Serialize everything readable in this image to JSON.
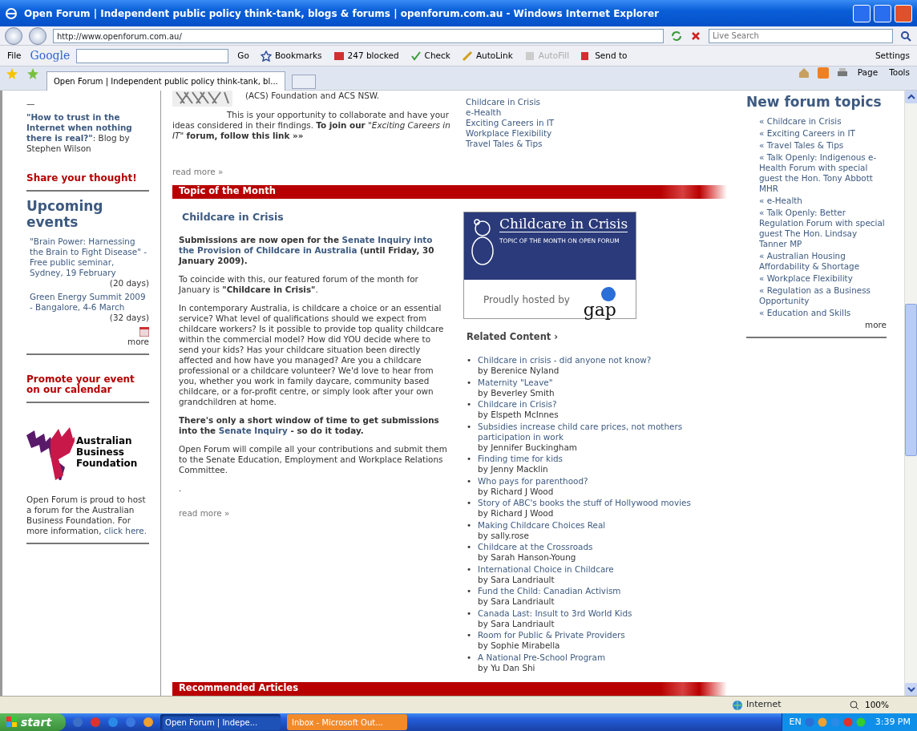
{
  "window": {
    "title": "Open Forum | Independent public policy think-tank, blogs & forums | openforum.com.au - Windows Internet Explorer"
  },
  "address_bar": {
    "url": "http://www.openforum.com.au/",
    "search_placeholder": "Live Search"
  },
  "google_toolbar": {
    "menu": "File",
    "brand": "Google",
    "go": "Go",
    "items": [
      {
        "label": "Bookmarks",
        "kind": "bookmarks",
        "disabled": false
      },
      {
        "label": "247 blocked",
        "kind": "blocked",
        "disabled": false
      },
      {
        "label": "Check",
        "kind": "check",
        "disabled": false
      },
      {
        "label": "AutoLink",
        "kind": "autolink",
        "disabled": false
      },
      {
        "label": "AutoFill",
        "kind": "autofill",
        "disabled": true
      },
      {
        "label": "Send to",
        "kind": "sendto",
        "disabled": false
      }
    ],
    "settings": "Settings"
  },
  "tabs": [
    {
      "label": "Open Forum | Independent public policy think-tank, bl...",
      "selected": true
    }
  ],
  "command_bar": {
    "page": "Page",
    "tools": "Tools"
  },
  "left_column": {
    "dash": "—",
    "blog": "**\"How to trust in the Internet when nothing there is real?\"**: Blog by Stephen Wilson",
    "share": "Share your thought!",
    "events_heading": "Upcoming events",
    "events": [
      {
        "title": "\"Brain Power: Harnessing the Brain to Fight Disease\" - Free public seminar, Sydney, 19 February",
        "days": "(20 days)"
      },
      {
        "title": "Green Energy Summit 2009 - Bangalore, 4-6 March",
        "days": "(32 days)"
      }
    ],
    "more": "more",
    "promote": "Promote your event on our calendar",
    "logo_lines": [
      "Australian",
      "Business",
      "Foundation"
    ],
    "sponsor_text": "Open Forum is proud to host a forum for the Australian Business Foundation. For more information,",
    "sponsor_link": "click here."
  },
  "intro": {
    "cut_line": "(ACS) Foundation and ACS NSW.",
    "text": "This is your opportunity to collaborate and have your ideas considered in their findings. **To join our** *\"Exciting Careers in IT\"* **forum, follow this link »»**",
    "read_more": "read more »"
  },
  "forum_links": [
    "Childcare in Crisis",
    "e-Health",
    "Exciting Careers in IT",
    "Workplace Flexibility",
    "Travel Tales & Tips"
  ],
  "topic_of_month": {
    "heading": "Topic of the Month",
    "title": "Childcare in Crisis",
    "paragraphs": [
      {
        "bold": true,
        "segments": [
          {
            "kind": "text",
            "text": "Submissions are now open for the "
          },
          {
            "kind": "link",
            "text": "Senate Inquiry into the Provision of Childcare in Australia"
          },
          {
            "kind": "text",
            "text": " (until Friday, 30 January 2009)."
          }
        ]
      },
      {
        "bold": false,
        "segments": [
          {
            "kind": "text",
            "text": "To coincide with this, our featured forum of the month for January is **\"Childcare in Crisis\"**."
          }
        ]
      },
      {
        "bold": false,
        "segments": [
          {
            "kind": "text",
            "text": "In contemporary Australia, is childcare a choice or an essential service? What level of qualifications should we expect from childcare workers? Is it possible to provide top quality childcare within the commercial model? How did YOU decide where to send your kids? Has your childcare situation been directly affected and how have you managed? Are you a childcare professional or a childcare volunteer? We'd love to hear from you, whether you work in family daycare, community based childcare, or a for-profit centre, or simply look after your own grandchildren at home."
          }
        ]
      },
      {
        "bold": true,
        "segments": [
          {
            "kind": "text",
            "text": "There's only a short window of time to get submissions into the "
          },
          {
            "kind": "link",
            "text": "Senate Inquiry"
          },
          {
            "kind": "text",
            "text": " - so do it today."
          }
        ]
      },
      {
        "bold": false,
        "segments": [
          {
            "kind": "text",
            "text": "Open Forum will compile all your contributions and submit them to the Senate Education, Employment and Workplace Relations Committee."
          }
        ]
      },
      {
        "bold": false,
        "segments": [
          {
            "kind": "text",
            "text": "."
          }
        ]
      }
    ],
    "read_more": "read more »",
    "banner": {
      "title": "Childcare in Crisis",
      "subtitle": "TOPIC OF THE MONTH ON OPEN FORUM",
      "hosted": "Proudly hosted by",
      "brand": "gap"
    },
    "related_heading": "Related Content ›",
    "bullet": "•",
    "related": [
      {
        "title": "Childcare in crisis - did anyone not know?",
        "author": "by Berenice Nyland"
      },
      {
        "title": "Maternity \"Leave\"",
        "author": "by Beverley Smith"
      },
      {
        "title": "Childcare in Crisis?",
        "author": "by Elspeth McInnes"
      },
      {
        "title": "Subsidies increase child care prices, not mothers participation in work",
        "author": "by Jennifer Buckingham"
      },
      {
        "title": "Finding time for kids",
        "author": "by Jenny Macklin"
      },
      {
        "title": "Who pays for parenthood?",
        "author": "by Richard J Wood"
      },
      {
        "title": "Story of ABC's books the stuff of Hollywood movies",
        "author": "by Richard J Wood"
      },
      {
        "title": "Making Childcare Choices Real",
        "author": "by sally.rose"
      },
      {
        "title": "Childcare at the Crossroads",
        "author": "by Sarah Hanson-Young"
      },
      {
        "title": "International Choice in Childcare",
        "author": "by Sara Landriault"
      },
      {
        "title": "Fund the Child: Canadian Activism",
        "author": "by Sara Landriault"
      },
      {
        "title": "Canada Last: Insult to 3rd World Kids",
        "author": "by Sara Landriault"
      },
      {
        "title": "Room for Public & Private Providers",
        "author": "by Sophie Mirabella"
      },
      {
        "title": "A National Pre-School Program",
        "author": "by Yu Dan Shi"
      }
    ]
  },
  "recommended": {
    "heading": "Recommended Articles"
  },
  "right_column": {
    "heading": "New forum topics",
    "topics": [
      "« Childcare in Crisis",
      "« Exciting Careers in IT",
      "« Travel Tales & Tips",
      "« Talk Openly: Indigenous e-Health Forum with special guest the Hon. Tony Abbott MHR",
      "« e-Health",
      "« Talk Openly: Better Regulation Forum with special guest The Hon. Lindsay Tanner MP",
      "« Australian Housing Affordability & Shortage",
      "« Workplace Flexibility",
      "« Regulation as a Business Opportunity",
      "« Education and Skills"
    ],
    "more": "more"
  },
  "status_bar": {
    "zone": "Internet",
    "zoom": "100%"
  },
  "taskbar": {
    "start": "start",
    "tasks": [
      {
        "label": "Open Forum | Indepe...",
        "selected": true,
        "flashing": false
      },
      {
        "label": "Inbox - Microsoft Out...",
        "selected": false,
        "flashing": true
      }
    ],
    "language": "EN",
    "clock": "3:39 PM"
  }
}
